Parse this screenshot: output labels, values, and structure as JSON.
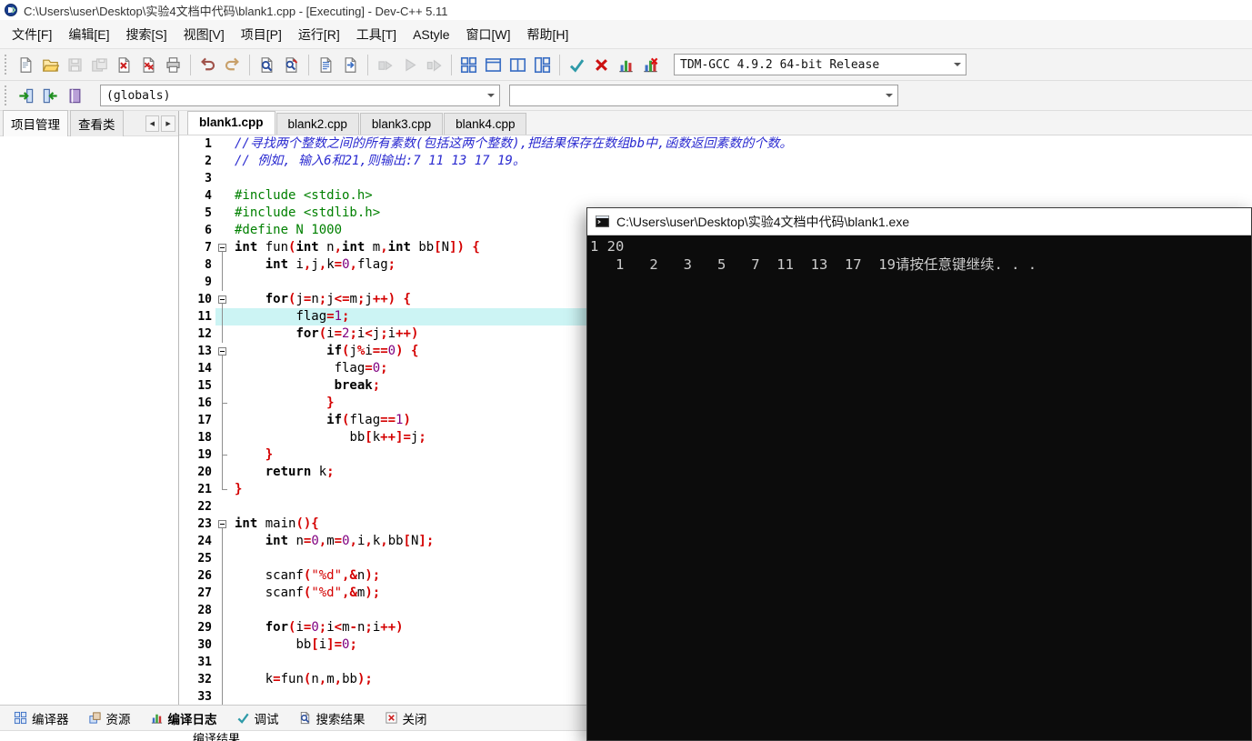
{
  "window": {
    "icon": "devcpp-logo",
    "title": "C:\\Users\\user\\Desktop\\实验4文档中代码\\blank1.cpp - [Executing] - Dev-C++ 5.11"
  },
  "menubar": {
    "items": [
      "文件[F]",
      "编辑[E]",
      "搜索[S]",
      "视图[V]",
      "项目[P]",
      "运行[R]",
      "工具[T]",
      "AStyle",
      "窗口[W]",
      "帮助[H]"
    ]
  },
  "toolbar_top": {
    "groups": [
      [
        {
          "name": "new-file",
          "disabled": false
        },
        {
          "name": "open-file",
          "disabled": false
        },
        {
          "name": "save",
          "disabled": true
        },
        {
          "name": "save-all",
          "disabled": true
        },
        {
          "name": "close-file",
          "disabled": false
        },
        {
          "name": "close-all",
          "disabled": false
        },
        {
          "name": "print",
          "disabled": false
        }
      ],
      [
        {
          "name": "undo",
          "disabled": false
        },
        {
          "name": "redo",
          "disabled": false
        }
      ],
      [
        {
          "name": "find",
          "disabled": false
        },
        {
          "name": "replace",
          "disabled": false
        }
      ],
      [
        {
          "name": "source-list",
          "disabled": false
        },
        {
          "name": "source-goto",
          "disabled": false
        }
      ],
      [
        {
          "name": "compile",
          "disabled": true
        },
        {
          "name": "run",
          "disabled": true
        },
        {
          "name": "compile-run",
          "disabled": true
        }
      ],
      [
        {
          "name": "project-new-unit",
          "disabled": false
        },
        {
          "name": "project-window",
          "disabled": false
        },
        {
          "name": "project-split",
          "disabled": false
        },
        {
          "name": "project-columns",
          "disabled": false
        }
      ],
      [
        {
          "name": "debug-check",
          "disabled": false
        },
        {
          "name": "abort",
          "disabled": false
        },
        {
          "name": "profile",
          "disabled": false
        },
        {
          "name": "profile-delete",
          "disabled": false
        }
      ]
    ],
    "compiler_select": "TDM-GCC 4.9.2 64-bit Release"
  },
  "toolbar_class": {
    "buttons": [
      {
        "name": "goto-declaration",
        "disabled": false
      },
      {
        "name": "goto-definition",
        "disabled": false
      },
      {
        "name": "class-browser",
        "disabled": false
      }
    ],
    "globals_select": "(globals)",
    "members_select": ""
  },
  "sidebar": {
    "tabs": [
      {
        "label": "项目管理",
        "active": true
      },
      {
        "label": "查看类",
        "active": false
      }
    ],
    "scroll_left": "◀",
    "scroll_right": "▶"
  },
  "editor": {
    "tabs": [
      {
        "label": "blank1.cpp",
        "active": true
      },
      {
        "label": "blank2.cpp",
        "active": false
      },
      {
        "label": "blank3.cpp",
        "active": false
      },
      {
        "label": "blank4.cpp",
        "active": false
      }
    ],
    "highlight_line": 11,
    "lines": [
      {
        "n": 1,
        "f": "",
        "t": [
          [
            "c",
            "//寻找两个整数之间的所有素数(包括这两个整数),把结果保存在数组bb中,函数返回素数的个数。"
          ]
        ]
      },
      {
        "n": 2,
        "f": "",
        "t": [
          [
            "c",
            "// 例如, 输入6和21,则输出:7 11 13 17 19。"
          ]
        ]
      },
      {
        "n": 3,
        "f": "",
        "t": []
      },
      {
        "n": 4,
        "f": "",
        "t": [
          [
            "g",
            "#include <stdio.h>"
          ]
        ]
      },
      {
        "n": 5,
        "f": "",
        "t": [
          [
            "g",
            "#include <stdlib.h>"
          ]
        ]
      },
      {
        "n": 6,
        "f": "",
        "t": [
          [
            "g",
            "#define N 1000"
          ]
        ]
      },
      {
        "n": 7,
        "f": "box",
        "t": [
          [
            "k",
            "int"
          ],
          [
            "p",
            " fun"
          ],
          [
            "s",
            "("
          ],
          [
            "k",
            "int"
          ],
          [
            "p",
            " n"
          ],
          [
            "s",
            ","
          ],
          [
            "k",
            "int"
          ],
          [
            "p",
            " m"
          ],
          [
            "s",
            ","
          ],
          [
            "k",
            "int"
          ],
          [
            "p",
            " bb"
          ],
          [
            "s",
            "["
          ],
          [
            "p",
            "N"
          ],
          [
            "s",
            "])"
          ],
          [
            "p",
            " "
          ],
          [
            "s",
            "{"
          ]
        ]
      },
      {
        "n": 8,
        "f": "line",
        "t": [
          [
            "p",
            "    "
          ],
          [
            "k",
            "int"
          ],
          [
            "p",
            " i"
          ],
          [
            "s",
            ","
          ],
          [
            "p",
            "j"
          ],
          [
            "s",
            ","
          ],
          [
            "p",
            "k"
          ],
          [
            "s",
            "="
          ],
          [
            "n",
            "0"
          ],
          [
            "s",
            ","
          ],
          [
            "p",
            "flag"
          ],
          [
            "s",
            ";"
          ]
        ]
      },
      {
        "n": 9,
        "f": "line",
        "t": []
      },
      {
        "n": 10,
        "f": "box",
        "t": [
          [
            "p",
            "    "
          ],
          [
            "k",
            "for"
          ],
          [
            "s",
            "("
          ],
          [
            "p",
            "j"
          ],
          [
            "s",
            "="
          ],
          [
            "p",
            "n"
          ],
          [
            "s",
            ";"
          ],
          [
            "p",
            "j"
          ],
          [
            "s",
            "<="
          ],
          [
            "p",
            "m"
          ],
          [
            "s",
            ";"
          ],
          [
            "p",
            "j"
          ],
          [
            "s",
            "++)"
          ],
          [
            "p",
            " "
          ],
          [
            "s",
            "{"
          ]
        ]
      },
      {
        "n": 11,
        "f": "line",
        "t": [
          [
            "p",
            "        "
          ],
          [
            "p",
            "flag"
          ],
          [
            "s",
            "="
          ],
          [
            "n",
            "1"
          ],
          [
            "s",
            ";"
          ]
        ]
      },
      {
        "n": 12,
        "f": "line",
        "t": [
          [
            "p",
            "        "
          ],
          [
            "k",
            "for"
          ],
          [
            "s",
            "("
          ],
          [
            "p",
            "i"
          ],
          [
            "s",
            "="
          ],
          [
            "n",
            "2"
          ],
          [
            "s",
            ";"
          ],
          [
            "p",
            "i"
          ],
          [
            "s",
            "<"
          ],
          [
            "p",
            "j"
          ],
          [
            "s",
            ";"
          ],
          [
            "p",
            "i"
          ],
          [
            "s",
            "++)"
          ]
        ]
      },
      {
        "n": 13,
        "f": "box",
        "t": [
          [
            "p",
            "            "
          ],
          [
            "k",
            "if"
          ],
          [
            "s",
            "("
          ],
          [
            "p",
            "j"
          ],
          [
            "s",
            "%"
          ],
          [
            "p",
            "i"
          ],
          [
            "s",
            "=="
          ],
          [
            "n",
            "0"
          ],
          [
            "s",
            ")"
          ],
          [
            "p",
            " "
          ],
          [
            "s",
            "{"
          ]
        ]
      },
      {
        "n": 14,
        "f": "line",
        "t": [
          [
            "p",
            "             "
          ],
          [
            "p",
            "flag"
          ],
          [
            "s",
            "="
          ],
          [
            "n",
            "0"
          ],
          [
            "s",
            ";"
          ]
        ]
      },
      {
        "n": 15,
        "f": "line",
        "t": [
          [
            "p",
            "             "
          ],
          [
            "k",
            "break"
          ],
          [
            "s",
            ";"
          ]
        ]
      },
      {
        "n": 16,
        "f": "endc",
        "t": [
          [
            "p",
            "            "
          ],
          [
            "s",
            "}"
          ]
        ]
      },
      {
        "n": 17,
        "f": "line",
        "t": [
          [
            "p",
            "            "
          ],
          [
            "k",
            "if"
          ],
          [
            "s",
            "("
          ],
          [
            "p",
            "flag"
          ],
          [
            "s",
            "=="
          ],
          [
            "n",
            "1"
          ],
          [
            "s",
            ")"
          ]
        ]
      },
      {
        "n": 18,
        "f": "line",
        "t": [
          [
            "p",
            "               "
          ],
          [
            "p",
            "bb"
          ],
          [
            "s",
            "["
          ],
          [
            "p",
            "k"
          ],
          [
            "s",
            "++]="
          ],
          [
            "p",
            "j"
          ],
          [
            "s",
            ";"
          ]
        ]
      },
      {
        "n": 19,
        "f": "endc",
        "t": [
          [
            "p",
            "    "
          ],
          [
            "s",
            "}"
          ]
        ]
      },
      {
        "n": 20,
        "f": "line",
        "t": [
          [
            "p",
            "    "
          ],
          [
            "k",
            "return"
          ],
          [
            "p",
            " k"
          ],
          [
            "s",
            ";"
          ]
        ]
      },
      {
        "n": 21,
        "f": "end",
        "t": [
          [
            "s",
            "}"
          ]
        ]
      },
      {
        "n": 22,
        "f": "",
        "t": []
      },
      {
        "n": 23,
        "f": "box",
        "t": [
          [
            "k",
            "int"
          ],
          [
            "p",
            " main"
          ],
          [
            "s",
            "(){"
          ]
        ]
      },
      {
        "n": 24,
        "f": "line",
        "t": [
          [
            "p",
            "    "
          ],
          [
            "k",
            "int"
          ],
          [
            "p",
            " n"
          ],
          [
            "s",
            "="
          ],
          [
            "n",
            "0"
          ],
          [
            "s",
            ","
          ],
          [
            "p",
            "m"
          ],
          [
            "s",
            "="
          ],
          [
            "n",
            "0"
          ],
          [
            "s",
            ","
          ],
          [
            "p",
            "i"
          ],
          [
            "s",
            ","
          ],
          [
            "p",
            "k"
          ],
          [
            "s",
            ","
          ],
          [
            "p",
            "bb"
          ],
          [
            "s",
            "["
          ],
          [
            "p",
            "N"
          ],
          [
            "s",
            "];"
          ]
        ]
      },
      {
        "n": 25,
        "f": "line",
        "t": []
      },
      {
        "n": 26,
        "f": "line",
        "t": [
          [
            "p",
            "    "
          ],
          [
            "p",
            "scanf"
          ],
          [
            "s",
            "("
          ],
          [
            "t",
            "\"%d\""
          ],
          [
            "s",
            ",&"
          ],
          [
            "p",
            "n"
          ],
          [
            "s",
            ");"
          ]
        ]
      },
      {
        "n": 27,
        "f": "line",
        "t": [
          [
            "p",
            "    "
          ],
          [
            "p",
            "scanf"
          ],
          [
            "s",
            "("
          ],
          [
            "t",
            "\"%d\""
          ],
          [
            "s",
            ",&"
          ],
          [
            "p",
            "m"
          ],
          [
            "s",
            ");"
          ]
        ]
      },
      {
        "n": 28,
        "f": "line",
        "t": []
      },
      {
        "n": 29,
        "f": "line",
        "t": [
          [
            "p",
            "    "
          ],
          [
            "k",
            "for"
          ],
          [
            "s",
            "("
          ],
          [
            "p",
            "i"
          ],
          [
            "s",
            "="
          ],
          [
            "n",
            "0"
          ],
          [
            "s",
            ";"
          ],
          [
            "p",
            "i"
          ],
          [
            "s",
            "<"
          ],
          [
            "p",
            "m"
          ],
          [
            "s",
            "-"
          ],
          [
            "p",
            "n"
          ],
          [
            "s",
            ";"
          ],
          [
            "p",
            "i"
          ],
          [
            "s",
            "++)"
          ]
        ]
      },
      {
        "n": 30,
        "f": "line",
        "t": [
          [
            "p",
            "        "
          ],
          [
            "p",
            "bb"
          ],
          [
            "s",
            "["
          ],
          [
            "p",
            "i"
          ],
          [
            "s",
            "]="
          ],
          [
            "n",
            "0"
          ],
          [
            "s",
            ";"
          ]
        ]
      },
      {
        "n": 31,
        "f": "line",
        "t": []
      },
      {
        "n": 32,
        "f": "line",
        "t": [
          [
            "p",
            "    "
          ],
          [
            "p",
            "k"
          ],
          [
            "s",
            "="
          ],
          [
            "p",
            "fun"
          ],
          [
            "s",
            "("
          ],
          [
            "p",
            "n"
          ],
          [
            "s",
            ","
          ],
          [
            "p",
            "m"
          ],
          [
            "s",
            ","
          ],
          [
            "p",
            "bb"
          ],
          [
            "s",
            ");"
          ]
        ]
      },
      {
        "n": 33,
        "f": "line",
        "t": []
      }
    ]
  },
  "console": {
    "icon": "console",
    "title": "C:\\Users\\user\\Desktop\\实验4文档中代码\\blank1.exe",
    "lines": [
      "1 20",
      "   1   2   3   5   7  11  13  17  19请按任意键继续. . ."
    ]
  },
  "bottombar": {
    "tabs": [
      {
        "icon": "compiler-grid",
        "label": "编译器",
        "active": false
      },
      {
        "icon": "resource",
        "label": "资源",
        "active": false
      },
      {
        "icon": "compile-log-chart",
        "label": "编译日志",
        "active": true
      },
      {
        "icon": "debug-check",
        "label": "调试",
        "active": false
      },
      {
        "icon": "search-results",
        "label": "搜索结果",
        "active": false
      },
      {
        "icon": "close-panel",
        "label": "关闭",
        "active": false
      }
    ],
    "partial_log_text": "编译结果..."
  },
  "colors": {
    "comment": "#2b2bd0",
    "preprocessor": "#008000",
    "keyword": "#000000",
    "number": "#800080",
    "symbol": "#d40000",
    "string": "#d40000",
    "line_highlight": "#ccf4f4",
    "console_bg": "#0c0c0c",
    "console_text": "#cccccc"
  }
}
